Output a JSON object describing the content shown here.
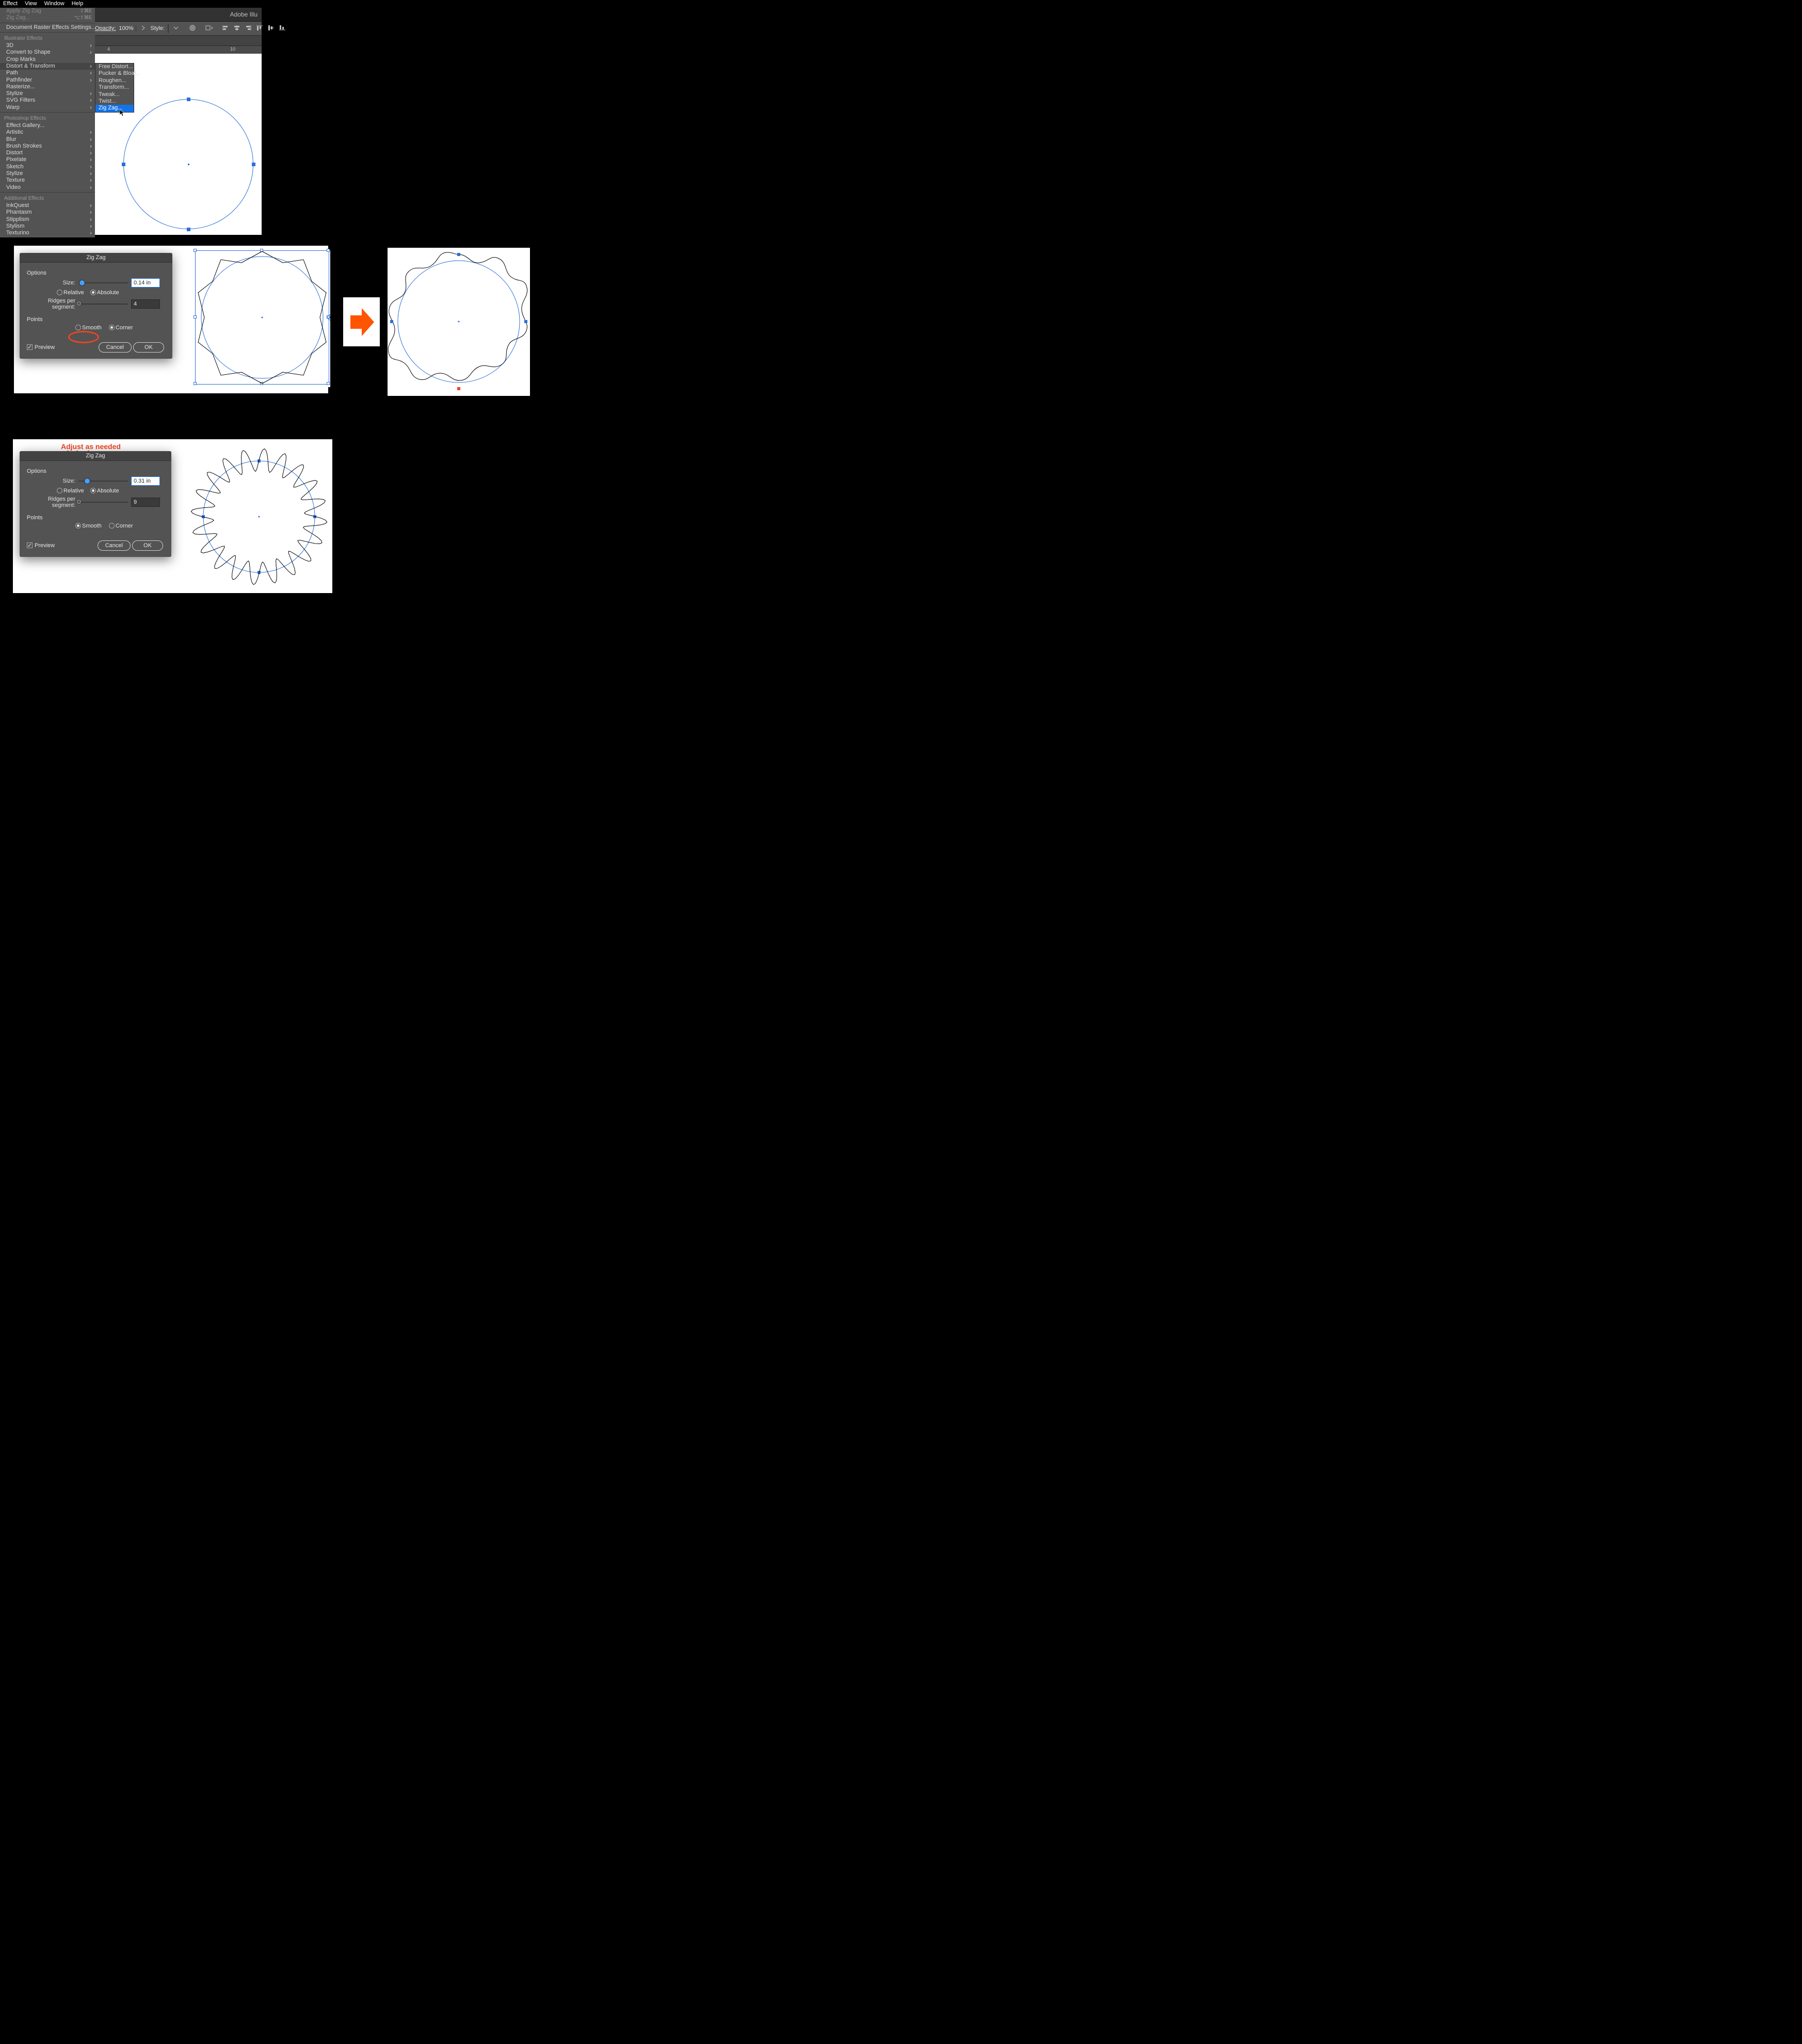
{
  "menubar": {
    "items": [
      "Effect",
      "View",
      "Window",
      "Help"
    ]
  },
  "app_title": "Adobe Illu",
  "options_bar": {
    "opacity_label": "Opacity:",
    "opacity_value": "100%",
    "style_label": "Style:"
  },
  "ruler_marks": {
    "m4": "4",
    "m10": "10"
  },
  "effect_menu": {
    "apply_last": "Apply Zig Zag",
    "apply_last_sc": "⇧⌘E",
    "last": "Zig Zag...",
    "last_sc": "⌥⇧⌘E",
    "doc_raster": "Document Raster Effects Settings...",
    "sect_illustrator": "Illustrator Effects",
    "items_illustrator": [
      "3D",
      "Convert to Shape",
      "Crop Marks",
      "Distort & Transform",
      "Path",
      "Pathfinder",
      "Rasterize...",
      "Stylize",
      "SVG Filters",
      "Warp"
    ],
    "sect_photoshop": "Photoshop Effects",
    "items_photoshop": [
      "Effect Gallery...",
      "Artistic",
      "Blur",
      "Brush Strokes",
      "Distort",
      "Pixelate",
      "Sketch",
      "Stylize",
      "Texture",
      "Video"
    ],
    "sect_additional": "Additional Effects",
    "items_additional": [
      "InkQuest",
      "Phantasm",
      "Stipplism",
      "Stylism",
      "Texturino"
    ]
  },
  "submenu_distort": {
    "items": [
      "Free Distort...",
      "Pucker & Bloat...",
      "Roughen...",
      "Transform...",
      "Tweak...",
      "Twist...",
      "Zig Zag..."
    ],
    "highlight_index": 6
  },
  "dialog2": {
    "title": "Zig Zag",
    "options_label": "Options",
    "size_label": "Size:",
    "size_value": "0.14 in",
    "relative": "Relative",
    "absolute": "Absolute",
    "absolute_selected": true,
    "ridges_label": "Ridges per segment:",
    "ridges_value": "4",
    "points_label": "Points",
    "smooth": "Smooth",
    "corner": "Corner",
    "corner_selected_index": 1,
    "preview": "Preview",
    "preview_on": true,
    "cancel": "Cancel",
    "ok": "OK"
  },
  "dialog3": {
    "title": "Zig Zag",
    "options_label": "Options",
    "size_label": "Size:",
    "size_value": "0.31 in",
    "relative": "Relative",
    "absolute": "Absolute",
    "absolute_selected": true,
    "ridges_label": "Ridges per segment:",
    "ridges_value": "9",
    "points_label": "Points",
    "smooth": "Smooth",
    "corner": "Corner",
    "smooth_selected": true,
    "preview": "Preview",
    "preview_on": true,
    "cancel": "Cancel",
    "ok": "OK"
  },
  "annotation_adjust": "Adjust as needed"
}
